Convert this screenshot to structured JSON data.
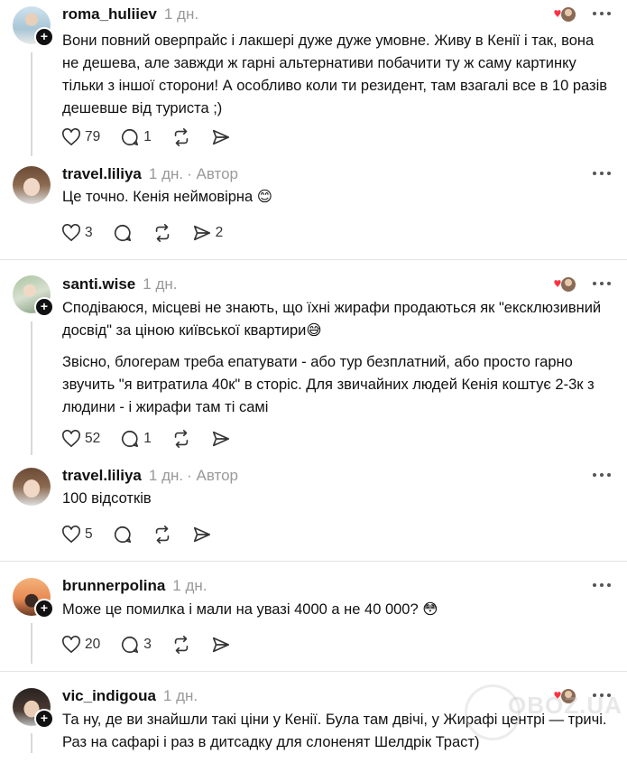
{
  "posts": [
    {
      "username": "roma_huliiev",
      "time": "1 дн.",
      "author_tag": "",
      "paragraphs": [
        "Вони повний оверпрайс і лакшері дуже дуже умовне. Живу в Кенії і так, вона не дешева, але завжди ж гарні альтернативи побачити ту ж саму картинку тільки з іншої сторони! А особливо коли ти резидент, там взагалі все в 10 разів дешевше від туриста ;)"
      ],
      "likes": "79",
      "replies": "1",
      "reposts": "",
      "shares": ""
    },
    {
      "username": "travel.liliya",
      "time": "1 дн.",
      "author_tag": "· Автор",
      "paragraphs": [
        "Це точно. Кенія неймовірна 😊"
      ],
      "likes": "3",
      "replies": "",
      "reposts": "",
      "shares": "2"
    },
    {
      "username": "santi.wise",
      "time": "1 дн.",
      "author_tag": "",
      "paragraphs": [
        "Сподіваюся, місцеві не знають, що їхні жирафи продаються як \"ексклюзивний досвід\" за ціною київської квартири😅",
        "Звісно, блогерам треба епатувати - або тур безплатний, або просто гарно звучить \"я витратила 40к\" в сторіс. Для звичайних людей Кенія коштує 2-3к з людини - і жирафи там ті самі"
      ],
      "likes": "52",
      "replies": "1",
      "reposts": "",
      "shares": ""
    },
    {
      "username": "travel.liliya",
      "time": "1 дн.",
      "author_tag": "· Автор",
      "paragraphs": [
        "100 відсотків"
      ],
      "likes": "5",
      "replies": "",
      "reposts": "",
      "shares": ""
    },
    {
      "username": "brunnerpolina",
      "time": "1 дн.",
      "author_tag": "",
      "paragraphs": [
        "Може це помилка і мали на увазі 4000 а не 40 000? 😳"
      ],
      "likes": "20",
      "replies": "3",
      "reposts": "",
      "shares": ""
    },
    {
      "username": "vic_indigoua",
      "time": "1 дн.",
      "author_tag": "",
      "paragraphs": [
        "Та ну, де ви знайшли такі ціни у Кенії. Була там двічі, у Жирафі центрі — тричі. Раз на сафарі і раз в дитсадку для слоненят Шелдрік Траст)"
      ],
      "likes": "",
      "replies": "",
      "reposts": "",
      "shares": ""
    }
  ],
  "watermark": "OBOZ.UA",
  "colors": {
    "like_red": "#ff3040",
    "muted": "#999999",
    "divider": "#e4e4e4"
  },
  "icons": {
    "like": "heart-icon",
    "reply": "comment-icon",
    "repost": "repost-icon",
    "share": "send-icon",
    "more": "more-icon"
  }
}
